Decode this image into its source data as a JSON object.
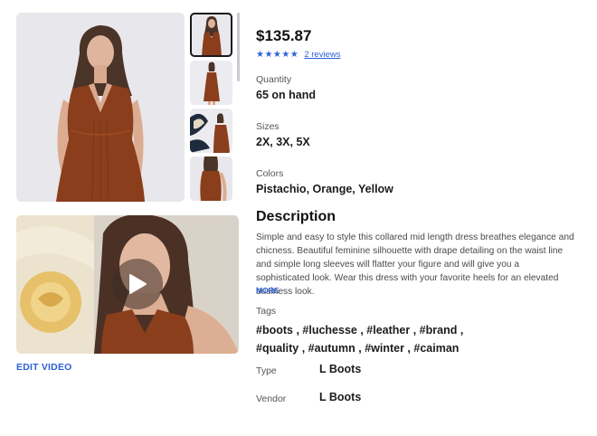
{
  "product": {
    "price": "$135.87",
    "rating_stars": "★★★★★",
    "reviews_link": "2 reviews"
  },
  "quantity": {
    "label": "Quantity",
    "value": "65 on hand"
  },
  "sizes": {
    "label": "Sizes",
    "value": "2X, 3X, 5X"
  },
  "colors": {
    "label": "Colors",
    "value": "Pistachio, Orange, Yellow"
  },
  "description": {
    "title": "Description",
    "text": "Simple and easy to style this collared mid length dress breathes elegance and chicness. Beautiful feminine silhouette with drape detailing on the waist line and simple long sleeves will flatter your figure and will give you a sophisticated look. Wear this dress with your favorite heels for an elevated business look.",
    "more_label": "MORE"
  },
  "tags": {
    "label": "Tags",
    "items": [
      "#boots",
      "#luchesse",
      "#leather",
      "#brand",
      "#quality",
      "#autumn",
      "#winter",
      "#caiman"
    ]
  },
  "type": {
    "label": "Type",
    "value": "L Boots"
  },
  "vendor": {
    "label": "Vendor",
    "value": "L Boots"
  },
  "media": {
    "edit_video_label": "EDIT VIDEO",
    "thumbnail_count": 4,
    "selected_thumbnail": 1
  },
  "colors_theme": {
    "accent": "#2c5fd8",
    "dress": "#8a3e1c"
  }
}
